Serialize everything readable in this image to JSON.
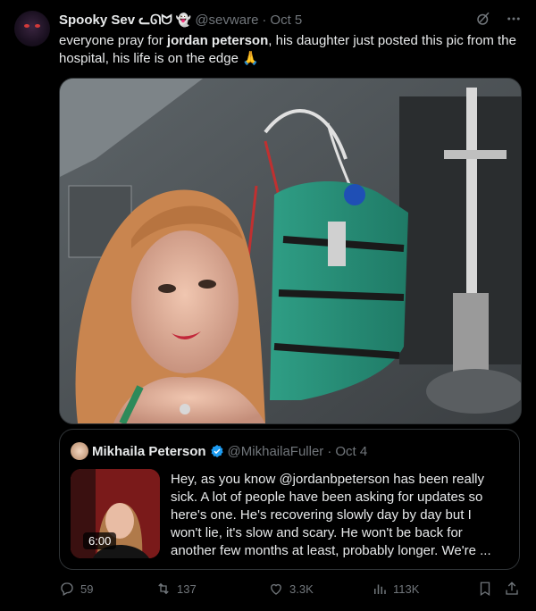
{
  "author": {
    "name": "Spooky Sev ᓚᘏᗢ",
    "badge_emoji": "👻",
    "handle": "@sevware",
    "separator": "·",
    "date": "Oct 5"
  },
  "tweet_text": {
    "part1": "everyone pray for ",
    "bold": "jordan peterson",
    "part2": ", his daughter just posted this pic from the hospital, his life is on the edge 🙏"
  },
  "quote": {
    "name": "Mikhaila Peterson",
    "handle": "@MikhailaFuller",
    "separator": "·",
    "date": "Oct 4",
    "video_duration": "6:00",
    "text": "Hey, as you know @jordanbpeterson has been really sick. A lot of people have been asking for updates so here's one. He's recovering slowly day by day but I won't lie, it's slow and scary. He won't be back for another few months at least, probably longer. We're ..."
  },
  "actions": {
    "replies": "59",
    "retweets": "137",
    "likes": "3.3K",
    "views": "113K"
  },
  "colors": {
    "background": "#000000",
    "text": "#e7e9ea",
    "muted": "#71767b",
    "border": "#2f3336",
    "verified": "#1d9bf0",
    "verified_quote": "#e2b719"
  }
}
